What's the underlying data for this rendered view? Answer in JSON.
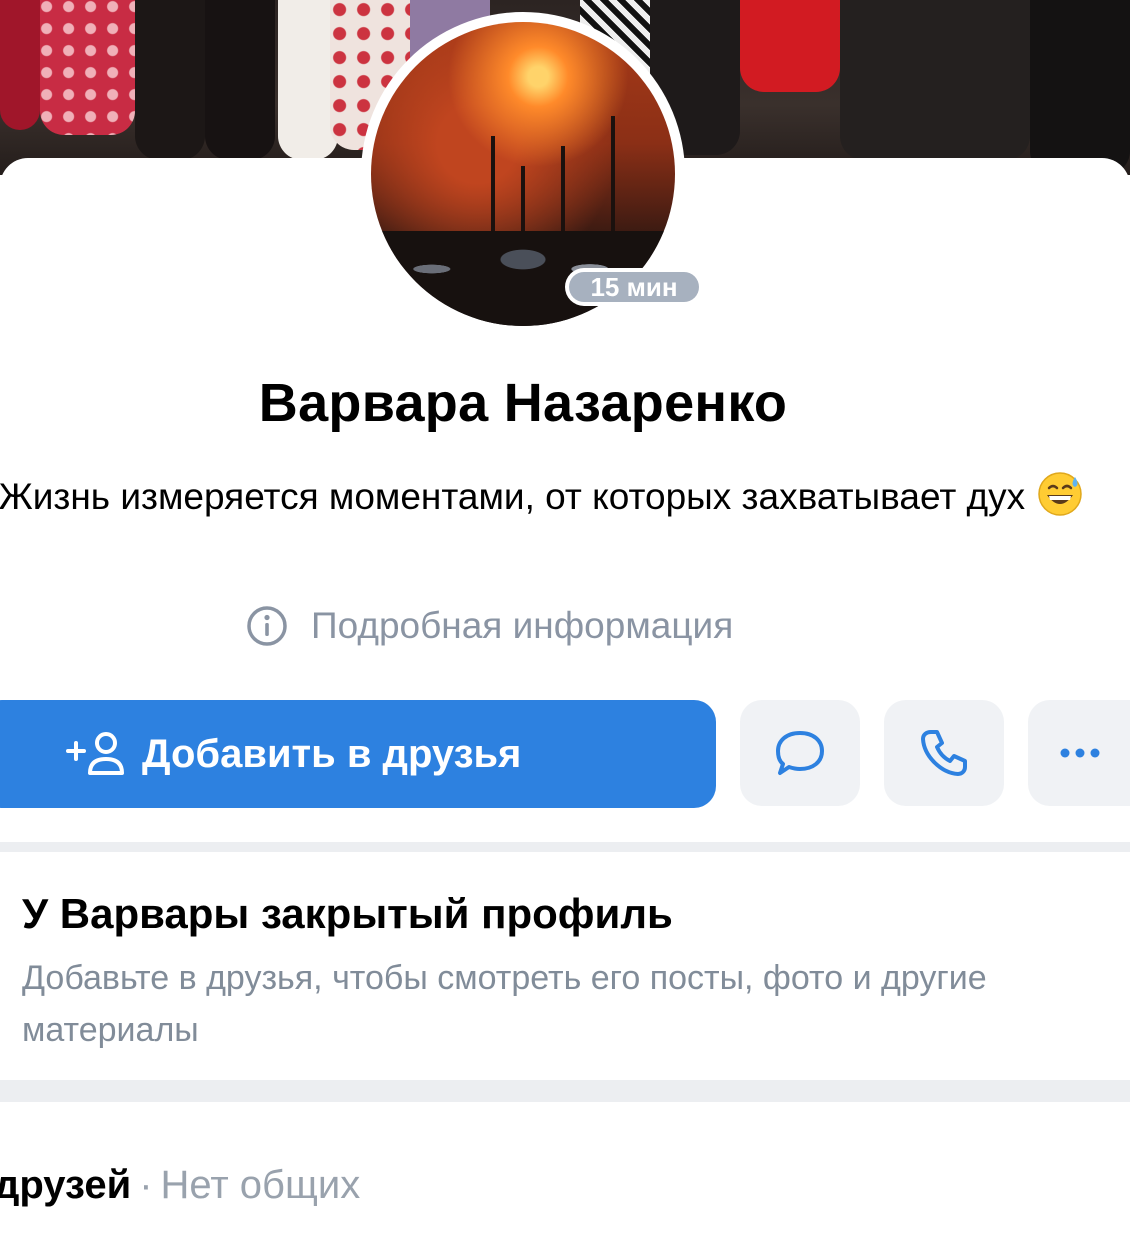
{
  "avatar": {
    "status_badge": "15 мин"
  },
  "profile": {
    "name": "Варвара Назаренко",
    "bio": "Жизнь измеряется моментами, от которых захватывает дух",
    "bio_emoji": "grinning-sweat-emoji",
    "details_link": "Подробная информация"
  },
  "actions": {
    "add_friend": "Добавить в друзья",
    "message_icon": "message-bubble-icon",
    "call_icon": "phone-icon",
    "more_icon": "more-dots-icon"
  },
  "closed_profile": {
    "title": "У Варвары закрытый профиль",
    "text": "Добавьте в друзья, чтобы смотреть его посты, фото и другие материалы"
  },
  "friends": {
    "label": "друзей",
    "separator": "·",
    "common": "Нет общих"
  },
  "colors": {
    "primary_button": "#2d81e0",
    "secondary_button_bg": "#f0f2f5",
    "secondary_text": "#818c99",
    "badge": "#a7b1bf"
  }
}
